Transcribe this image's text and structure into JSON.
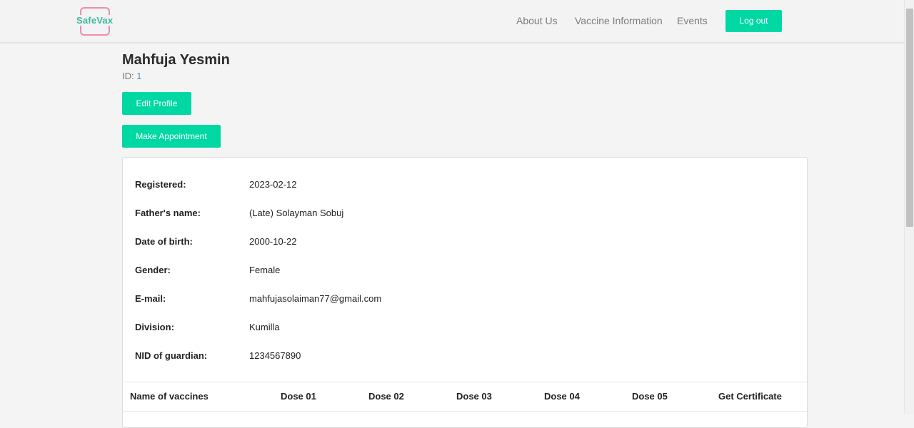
{
  "header": {
    "logo_text": "SafeVax",
    "nav": [
      "About Us",
      "Vaccine Information",
      "Events"
    ],
    "logout_label": "Log out"
  },
  "profile": {
    "name": "Mahfuja Yesmin",
    "id_label": "ID:",
    "id_value": "1",
    "edit_label": "Edit Profile",
    "appointment_label": "Make Appointment"
  },
  "details": [
    {
      "label": "Registered:",
      "value": "2023-02-12"
    },
    {
      "label": "Father's name:",
      "value": "(Late) Solayman Sobuj"
    },
    {
      "label": "Date of birth:",
      "value": "2000-10-22"
    },
    {
      "label": "Gender:",
      "value": "Female"
    },
    {
      "label": "E-mail:",
      "value": "mahfujasolaiman77@gmail.com"
    },
    {
      "label": "Division:",
      "value": "Kumilla"
    },
    {
      "label": "NID of guardian:",
      "value": "1234567890"
    }
  ],
  "table": {
    "headers": [
      "Name of vaccines",
      "Dose 01",
      "Dose 02",
      "Dose 03",
      "Dose 04",
      "Dose 05",
      "Get Certificate"
    ]
  },
  "colors": {
    "accent": "#00d8a4",
    "logo_border": "#f08bb1",
    "logo_text": "#3cb7a0"
  }
}
